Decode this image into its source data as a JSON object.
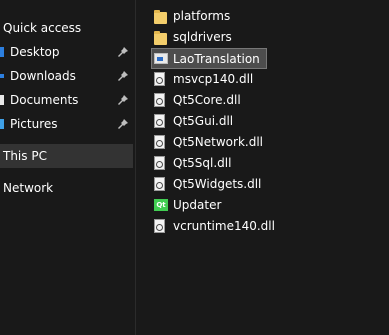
{
  "nav": {
    "quick_access": "Quick access",
    "pinned": [
      {
        "label": "Desktop",
        "marker_color": "#2c7fe0"
      },
      {
        "label": "Downloads",
        "marker_color": "#2c7fe0"
      },
      {
        "label": "Documents",
        "marker_color": "#e8e8e8"
      },
      {
        "label": "Pictures",
        "marker_color": "#3fa0e6"
      }
    ],
    "this_pc": "This PC",
    "network": "Network"
  },
  "files": [
    {
      "name": "platforms",
      "icon": "folder-icon"
    },
    {
      "name": "sqldrivers",
      "icon": "folder-icon"
    },
    {
      "name": "LaoTranslation",
      "icon": "application-icon",
      "selected": true
    },
    {
      "name": "msvcp140.dll",
      "icon": "dll-icon"
    },
    {
      "name": "Qt5Core.dll",
      "icon": "dll-icon"
    },
    {
      "name": "Qt5Gui.dll",
      "icon": "dll-icon"
    },
    {
      "name": "Qt5Network.dll",
      "icon": "dll-icon"
    },
    {
      "name": "Qt5Sql.dll",
      "icon": "dll-icon"
    },
    {
      "name": "Qt5Widgets.dll",
      "icon": "dll-icon"
    },
    {
      "name": "Updater",
      "icon": "qt-app-icon",
      "icon_text": "Qt"
    },
    {
      "name": "vcruntime140.dll",
      "icon": "dll-icon"
    }
  ],
  "colors": {
    "background": "#191919",
    "selection": "#4d4d4d",
    "nav_selection": "#333333",
    "folder": "#f3cd6b",
    "qt_green": "#41cd52"
  }
}
